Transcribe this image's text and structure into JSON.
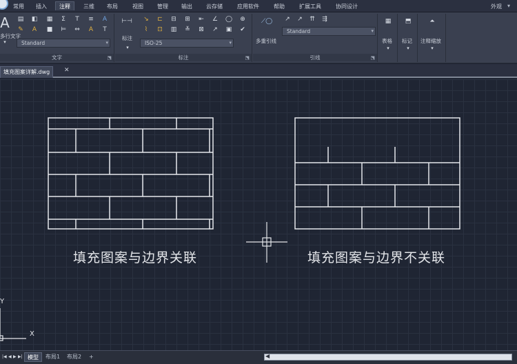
{
  "menubar": {
    "tabs": [
      "常用",
      "插入",
      "注释",
      "三维",
      "布局",
      "视图",
      "管理",
      "输出",
      "云存储",
      "应用软件",
      "帮助",
      "扩展工具",
      "协同设计"
    ],
    "active_tab": "注释",
    "right_label": "外观"
  },
  "ribbon": {
    "text_panel": {
      "title": "文字",
      "big_button": "多行文字",
      "style_combo": "Standard"
    },
    "dim_panel": {
      "title": "标注",
      "big_button": "标注",
      "style_combo": "ISO-25"
    },
    "leader_panel": {
      "title": "引线",
      "big_button": "多重引线",
      "style_combo": "Standard"
    },
    "table_button": "表格",
    "mark_button": "标记",
    "scale_button": "注释缩放"
  },
  "file_tab": {
    "name": "填充图案详解.dwg",
    "close": "✕"
  },
  "drawing": {
    "left_caption": "填充图案与边界关联",
    "right_caption": "填充图案与边界不关联",
    "ucs_x": "X",
    "ucs_y": "Y"
  },
  "layout_tabs": {
    "items": [
      "模型",
      "布局1",
      "布局2"
    ],
    "active": "模型",
    "add": "+"
  },
  "colors": {
    "canvas": "#1f2533",
    "ribbon": "#3a4050",
    "line": "#e6e8ec"
  }
}
